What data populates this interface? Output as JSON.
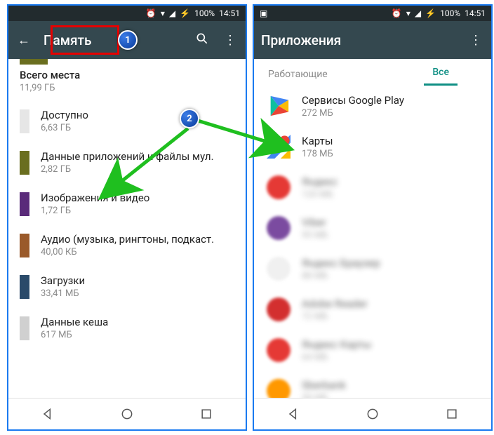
{
  "status": {
    "battery": "100%",
    "time": "14:51"
  },
  "phone1": {
    "title": "Память",
    "total_label": "Всего места",
    "total_value": "11,99 ГБ",
    "rows": [
      {
        "label": "Доступно",
        "value": "6,63 ГБ",
        "color": "#e6e6e6"
      },
      {
        "label": "Данные приложений и файлы мул.",
        "value": "2,82 ГБ",
        "color": "#6a6e1f"
      },
      {
        "label": "Изображения и видео",
        "value": "1,72 ГБ",
        "color": "#5a2b7a"
      },
      {
        "label": "Аудио (музыка, рингтоны, подкаст.",
        "value": "40,00 КБ",
        "color": "#9a5a2a"
      },
      {
        "label": "Загрузки",
        "value": "33,41 МБ",
        "color": "#2a4a6a"
      },
      {
        "label": "Данные кеша",
        "value": "617 МБ",
        "color": "#d0d0d0"
      }
    ]
  },
  "phone2": {
    "title": "Приложения",
    "tabs": {
      "inactive": "Работающие",
      "active": "Все"
    },
    "apps": [
      {
        "name": "Сервисы Google Play",
        "size": "272 МБ",
        "icon": "play",
        "blurred": false
      },
      {
        "name": "Карты",
        "size": "178 МБ",
        "icon": "maps",
        "blurred": false
      },
      {
        "name": "Яндекс",
        "size": "120 МБ",
        "icon": "red",
        "blurred": true
      },
      {
        "name": "Viber",
        "size": "95 МБ",
        "icon": "purple",
        "blurred": true
      },
      {
        "name": "Яндекс Браузер",
        "size": "88 МБ",
        "icon": "white",
        "blurred": true
      },
      {
        "name": "Adobe Reader",
        "size": "72 МБ",
        "icon": "redsq",
        "blurred": true
      },
      {
        "name": "Яндекс Карты",
        "size": "64 МБ",
        "icon": "red",
        "blurred": true
      },
      {
        "name": "Sberbank",
        "size": "58 МБ",
        "icon": "orange",
        "blurred": true
      }
    ]
  },
  "annotations": {
    "n1": "1",
    "n2": "2"
  }
}
